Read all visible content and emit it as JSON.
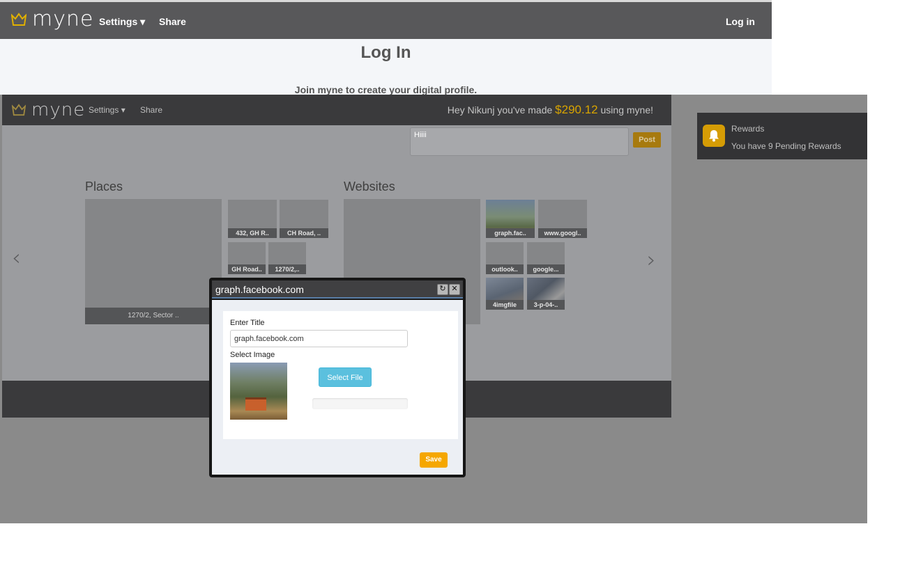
{
  "back_window": {
    "logo_text": "myne",
    "nav": {
      "settings": "Settings",
      "share": "Share",
      "login": "Log in"
    },
    "title": "Log In",
    "subtitle": "Join myne to create your digital profile."
  },
  "app": {
    "logo_text": "myne",
    "nav": {
      "settings": "Settings",
      "share": "Share"
    },
    "earnings": {
      "prefix": "Hey Nikunj you've made ",
      "amount": "$290.12",
      "suffix": " using myne!"
    },
    "post": {
      "text": "Hiiii",
      "button": "Post"
    },
    "sections": {
      "places": {
        "title": "Places",
        "big_tile": "1270/2, Sector ..",
        "tiles": [
          "432, GH R..",
          "CH Road, ..",
          "GH Road..",
          "1270/2,.."
        ]
      },
      "websites": {
        "title": "Websites",
        "tiles": [
          "graph.fac..",
          "www.googl..",
          "outlook..",
          "google...",
          "4imgfile",
          "3-p-04-.."
        ]
      }
    }
  },
  "rewards": {
    "title": "Rewards",
    "text": "You have 9 Pending Rewards"
  },
  "dialog": {
    "title": "graph.facebook.com",
    "title_label": "Enter Title",
    "title_value": "graph.facebook.com",
    "image_label": "Select Image",
    "select_file": "Select File",
    "save": "Save",
    "refresh_icon": "↻",
    "close_icon": "✕"
  },
  "colors": {
    "accent": "#f5a700",
    "info": "#5bc0de",
    "nav_dark": "#3a3a3c"
  }
}
